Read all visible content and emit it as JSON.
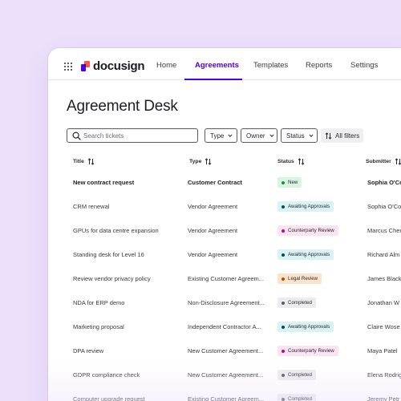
{
  "brand": {
    "name": "docusign"
  },
  "nav": {
    "tabs": [
      {
        "label": "Home",
        "active": false
      },
      {
        "label": "Agreements",
        "active": true
      },
      {
        "label": "Templates",
        "active": false
      },
      {
        "label": "Reports",
        "active": false
      },
      {
        "label": "Settings",
        "active": false
      }
    ]
  },
  "page": {
    "title": "Agreement Desk"
  },
  "filters": {
    "search_placeholder": "Search tickets",
    "type_label": "Type",
    "owner_label": "Owner",
    "status_label": "Status",
    "all_filters_label": "All filters"
  },
  "table": {
    "columns": [
      "Title",
      "Type",
      "Status",
      "Submitter"
    ],
    "rows": [
      {
        "title": "New contract request",
        "type": "Customer Contract",
        "status": "New",
        "status_kind": "new",
        "submitter": "Sophia O'Co",
        "bold": true
      },
      {
        "title": "CRM renewal",
        "type": "Vendor Agreement",
        "status": "Awaiting Approvals",
        "status_kind": "awaiting",
        "submitter": "Sophia O'Co",
        "bold": false
      },
      {
        "title": "GPUs for data centre expansion",
        "type": "Vendor Agreement",
        "status": "Counterparty Review",
        "status_kind": "counterparty",
        "submitter": "Marcus Cher",
        "bold": false
      },
      {
        "title": "Standing desk for Level 16",
        "type": "Vendor Agreement",
        "status": "Awaiting Approvals",
        "status_kind": "awaiting",
        "submitter": "Richard Alm",
        "bold": false
      },
      {
        "title": "Review vendor privacy policy",
        "type": "Existing Customer Agreem...",
        "status": "Legal Review",
        "status_kind": "legal",
        "submitter": "James Black",
        "bold": false
      },
      {
        "title": "NDA for ERP demo",
        "type": "Non-Disclosure Agreement...",
        "status": "Completed",
        "status_kind": "completed",
        "submitter": "Jonathan W",
        "bold": false
      },
      {
        "title": "Marketing proposal",
        "type": "Independent Contractor A...",
        "status": "Awaiting Approvals",
        "status_kind": "awaiting",
        "submitter": "Claire Wose",
        "bold": false
      },
      {
        "title": "DPA review",
        "type": "New Customer Agreement...",
        "status": "Counterparty Review",
        "status_kind": "counterparty",
        "submitter": "Maya Patel",
        "bold": false
      },
      {
        "title": "GDPR compliance check",
        "type": "New Customer Agreement...",
        "status": "Completed",
        "status_kind": "completed",
        "submitter": "Elena Rodrig",
        "bold": false
      },
      {
        "title": "Computer upgrade request",
        "type": "Existing Customer Agreem...",
        "status": "Completed",
        "status_kind": "completed",
        "submitter": "Jeremy Petr",
        "bold": false
      }
    ]
  },
  "colors": {
    "accent": "#4c00ff",
    "background": "#ece0fb",
    "new_bg": "#d8f5e3",
    "new_dot": "#1f8a4c",
    "awaiting_bg": "#d9f2f4",
    "awaiting_dot": "#0b4a5a",
    "counterparty_bg": "#fbe3f1",
    "counterparty_dot": "#b3126f",
    "legal_bg": "#fde3cc",
    "legal_dot": "#b84a00",
    "completed_bg": "#ececee",
    "completed_dot": "#5a5a62"
  }
}
